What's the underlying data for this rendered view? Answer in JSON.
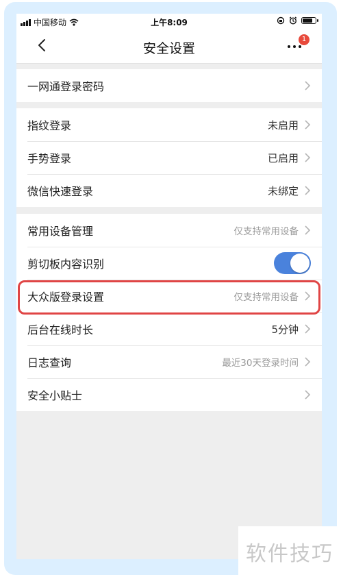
{
  "status_bar": {
    "carrier": "中国移动",
    "time": "上午8:09"
  },
  "nav": {
    "title": "安全设置",
    "badge_count": "1"
  },
  "groups": [
    {
      "rows": [
        {
          "label": "一网通登录密码",
          "value": ""
        }
      ]
    },
    {
      "rows": [
        {
          "label": "指纹登录",
          "value": "未启用"
        },
        {
          "label": "手势登录",
          "value": "已启用"
        },
        {
          "label": "微信快速登录",
          "value": "未绑定"
        }
      ]
    },
    {
      "rows": [
        {
          "label": "常用设备管理",
          "value": "仅支持常用设备"
        },
        {
          "label": "剪切板内容识别",
          "toggle": "on"
        },
        {
          "label": "大众版登录设置",
          "value": "仅支持常用设备"
        },
        {
          "label": "后台在线时长",
          "value": "5分钟"
        },
        {
          "label": "日志查询",
          "value": "最近30天登录时间"
        },
        {
          "label": "安全小贴士",
          "value": ""
        }
      ]
    }
  ],
  "watermark": "软件技巧",
  "colors": {
    "toggle_on": "#4a82dc",
    "highlight": "#e04545",
    "badge": "#e84a3c",
    "frame": "#dcefff"
  }
}
